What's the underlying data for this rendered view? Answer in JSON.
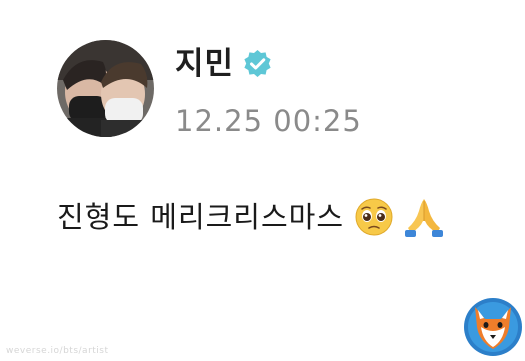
{
  "post": {
    "author_name": "지민",
    "timestamp": "12.25 00:25",
    "message": "진형도 메리크리스마스",
    "emojis": [
      "pleading-face",
      "folded-hands"
    ]
  },
  "icons": {
    "verified": "verified-check-icon",
    "logo": "fox-logo"
  },
  "watermark": {
    "text": "weverse.io/bts/artist"
  },
  "colors": {
    "verified_badge": "#5ec7d6",
    "timestamp": "#8a8a8a",
    "text": "#1a1a1a"
  }
}
